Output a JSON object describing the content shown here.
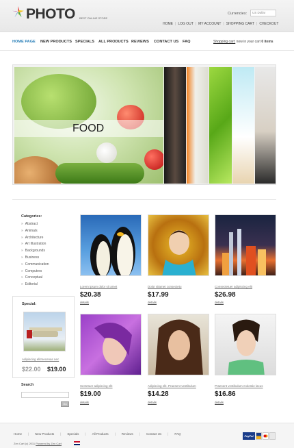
{
  "header": {
    "logo_text": "PHOTO",
    "tagline": "BEST ONLINE STORE",
    "currencies_label": "Currencies:",
    "currency_selected": "US Dollar",
    "top_links": [
      "HOME",
      "LOG OUT",
      "MY ACCOUNT",
      "SHOPPING CART",
      "CHECKOUT"
    ]
  },
  "nav": {
    "items": [
      "HOME PAGE",
      "NEW PRODUCTS",
      "SPECIALS",
      "ALL PRODUCTS",
      "REVIEWS",
      "CONTACT US",
      "FAQ"
    ],
    "cart_link": "Shopping cart:",
    "cart_text": "now in your cart",
    "cart_count": "0",
    "cart_items": "items"
  },
  "banner": {
    "label": "FOOD"
  },
  "sidebar": {
    "categories_title": "Categories:",
    "categories": [
      "Abstract",
      "Animals",
      "Architecture",
      "Art Illustration",
      "Backgrounds",
      "Business",
      "Communication",
      "Computers",
      "Conceptual",
      "Editorial"
    ],
    "special_title": "Special:",
    "special_name": "Adipiscing elitmecenas nec",
    "special_old_price": "$22.00",
    "special_new_price": "$19.00",
    "search_title": "Search",
    "search_button": "Go"
  },
  "products": [
    {
      "name": "Lorem ipsum dolor sit amet",
      "price": "$20.38",
      "details": "details"
    },
    {
      "name": "Dolor sitamet consectetu",
      "price": "$17.99",
      "details": "details"
    },
    {
      "name": "Consectetuer adipiscing elit",
      "price": "$26.98",
      "details": "details"
    },
    {
      "name": "Sectetuer adipiscing elit",
      "price": "$19.00",
      "details": "details"
    },
    {
      "name": "Adipiscing elit. Praesent vestibulum",
      "price": "$14.28",
      "details": "details"
    },
    {
      "name": "Praesent vestibulum molestie lacus",
      "price": "$16.86",
      "details": "details"
    }
  ],
  "footer": {
    "links": [
      "Home",
      "New Products",
      "Specials",
      "All Products",
      "Reviews",
      "Contact Us",
      "FAQ"
    ],
    "copyright_prefix": "Zen Cart (c) 2011",
    "powered_by": "Powered by Zen Cart",
    "paypal_label": "PayPal"
  }
}
